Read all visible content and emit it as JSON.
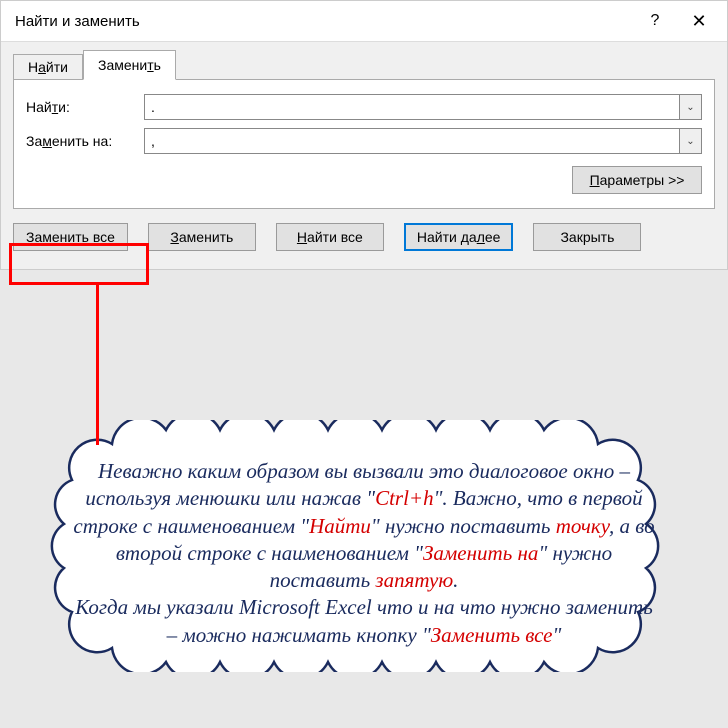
{
  "dialog": {
    "title": "Найти и заменить",
    "tabs": {
      "find": "Найти",
      "replace": "Заменить"
    },
    "labels": {
      "find": "Найти:",
      "replace": "Заменить на:"
    },
    "values": {
      "find": ".",
      "replace": ","
    },
    "params_btn": "Параметры >>",
    "buttons": {
      "replace_all": "Заменить все",
      "replace": "Заменить",
      "find_all": "Найти все",
      "find_next": "Найти далее",
      "close": "Закрыть"
    }
  },
  "note": {
    "t1": "Неважно каким образом вы вызвали это диалоговое окно – используя менюшки или нажав \"",
    "r1": "Ctrl+h",
    "t2": "\". Важно, что в первой строке с наименованием \"",
    "r2": "Найти",
    "t3": "\" нужно поставить ",
    "r3": "точку",
    "t4": ", а во второй строке с наименованием \"",
    "r4": "Заменить на",
    "t5": "\" нужно поставить ",
    "r5": "запятую",
    "t6": ".",
    "t7": "Когда мы указали Microsoft Excel что и на что нужно заменить – можно нажимать кнопку  \"",
    "r6": "Заменить все",
    "t8": "\""
  }
}
